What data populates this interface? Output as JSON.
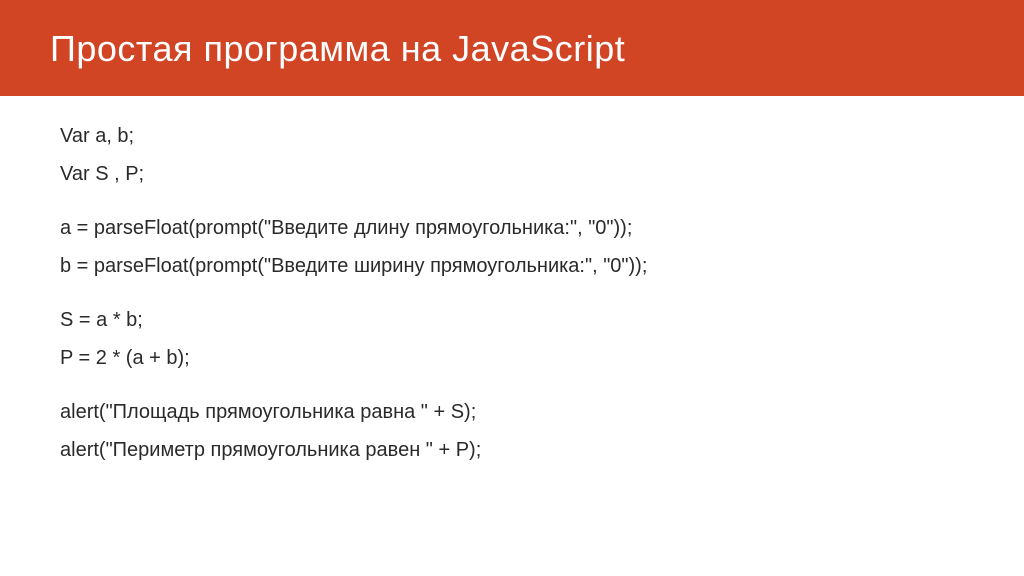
{
  "header": {
    "title": "Простая программа на JavaScript"
  },
  "code": {
    "block1": {
      "line1": "Var a, b;",
      "line2": "Var S , P;"
    },
    "block2": {
      "line1": "a = parseFloat(prompt(\"Введите длину прямоугольника:\", \"0\"));",
      "line2": "b = parseFloat(prompt(\"Введите ширину прямоугольника:\", \"0\"));"
    },
    "block3": {
      "line1": "S = a * b;",
      "line2": "P = 2 * (a + b);"
    },
    "block4": {
      "line1": "alert(\"Площадь прямоугольника равна \" + S);",
      "line2": "alert(\"Периметр прямоугольника равен \" + P);"
    }
  }
}
